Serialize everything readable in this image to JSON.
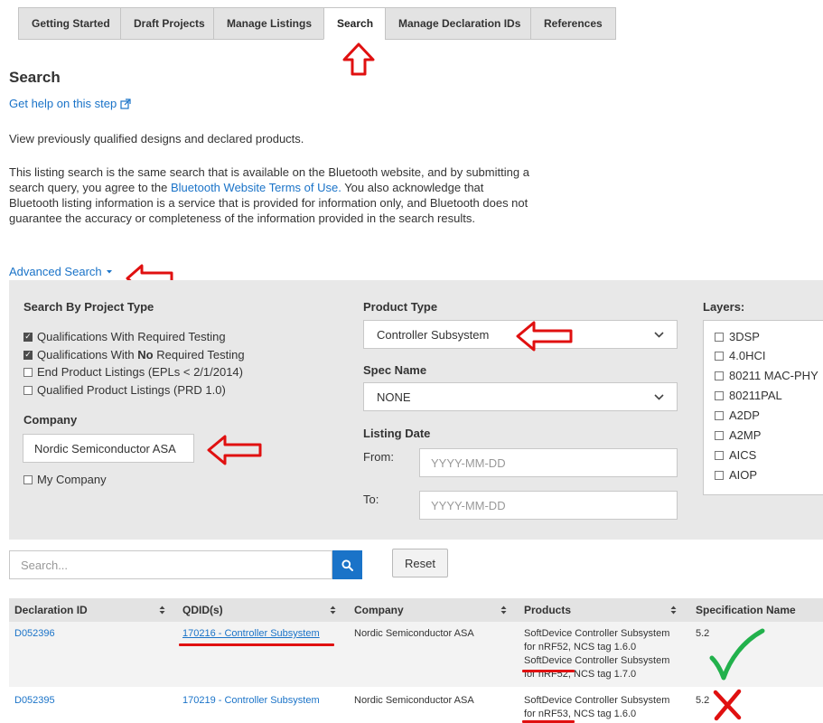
{
  "tabs": [
    {
      "label": "Getting Started"
    },
    {
      "label": "Draft Projects"
    },
    {
      "label": "Manage Listings"
    },
    {
      "label": "Search",
      "active": true
    },
    {
      "label": "Manage Declaration IDs"
    },
    {
      "label": "References"
    }
  ],
  "page": {
    "title": "Search",
    "help_link": "Get help on this step",
    "intro": "View previously qualified designs and declared products.",
    "legal_before": "This listing search is the same search that is available on the Bluetooth website, and by submitting a search query, you agree to the ",
    "legal_link": "Bluetooth Website Terms of Use.",
    "legal_after": " You also acknowledge that Bluetooth listing information is a service that is provided for information only, and Bluetooth does not guarantee the accuracy or completeness of the information provided in the search results."
  },
  "advanced": {
    "toggle_label": "Advanced Search",
    "project_type": {
      "heading": "Search By Project Type",
      "options": [
        {
          "label": "Qualifications With Required Testing",
          "checked": true
        },
        {
          "label_before": "Qualifications With ",
          "label_bold": "No",
          "label_after": " Required Testing",
          "checked": true
        },
        {
          "label": "End Product Listings (EPLs < 2/1/2014)",
          "checked": false
        },
        {
          "label": "Qualified Product Listings (PRD 1.0)",
          "checked": false
        }
      ]
    },
    "company": {
      "heading": "Company",
      "value": "Nordic Semiconductor ASA",
      "my_company_label": "My Company"
    },
    "product_type": {
      "heading": "Product Type",
      "value": "Controller Subsystem"
    },
    "spec_name": {
      "heading": "Spec Name",
      "value": "NONE"
    },
    "listing_date": {
      "heading": "Listing Date",
      "from_label": "From:",
      "to_label": "To:",
      "placeholder": "YYYY-MM-DD"
    },
    "layers": {
      "heading": "Layers:",
      "items": [
        "3DSP",
        "4.0HCI",
        "80211 MAC-PHY",
        "80211PAL",
        "A2DP",
        "A2MP",
        "AICS",
        "AIOP"
      ]
    }
  },
  "search": {
    "placeholder": "Search...",
    "reset_label": "Reset"
  },
  "table": {
    "headers": [
      "Declaration ID",
      "QDID(s)",
      "Company",
      "Products",
      "Specification Name"
    ],
    "rows": [
      {
        "declaration_id": "D052396",
        "qdid": "170216 - Controller Subsystem",
        "company": "Nordic Semiconductor ASA",
        "products": [
          "SoftDevice Controller Subsystem",
          "for nRF52, NCS tag 1.6.0",
          "SoftDevice Controller Subsystem",
          "for nRF52, NCS tag 1.7.0"
        ],
        "spec": "5.2"
      },
      {
        "declaration_id": "D052395",
        "qdid": "170219 - Controller Subsystem",
        "company": "Nordic Semiconductor ASA",
        "products": [
          "SoftDevice Controller Subsystem",
          "for nRF53, NCS tag 1.6.0"
        ],
        "spec": "5.2"
      }
    ]
  },
  "colors": {
    "link": "#1a73c8",
    "annotation_red": "#e01010",
    "checkmark_green": "#22b14c",
    "panel_bg": "#e8e8e8"
  }
}
